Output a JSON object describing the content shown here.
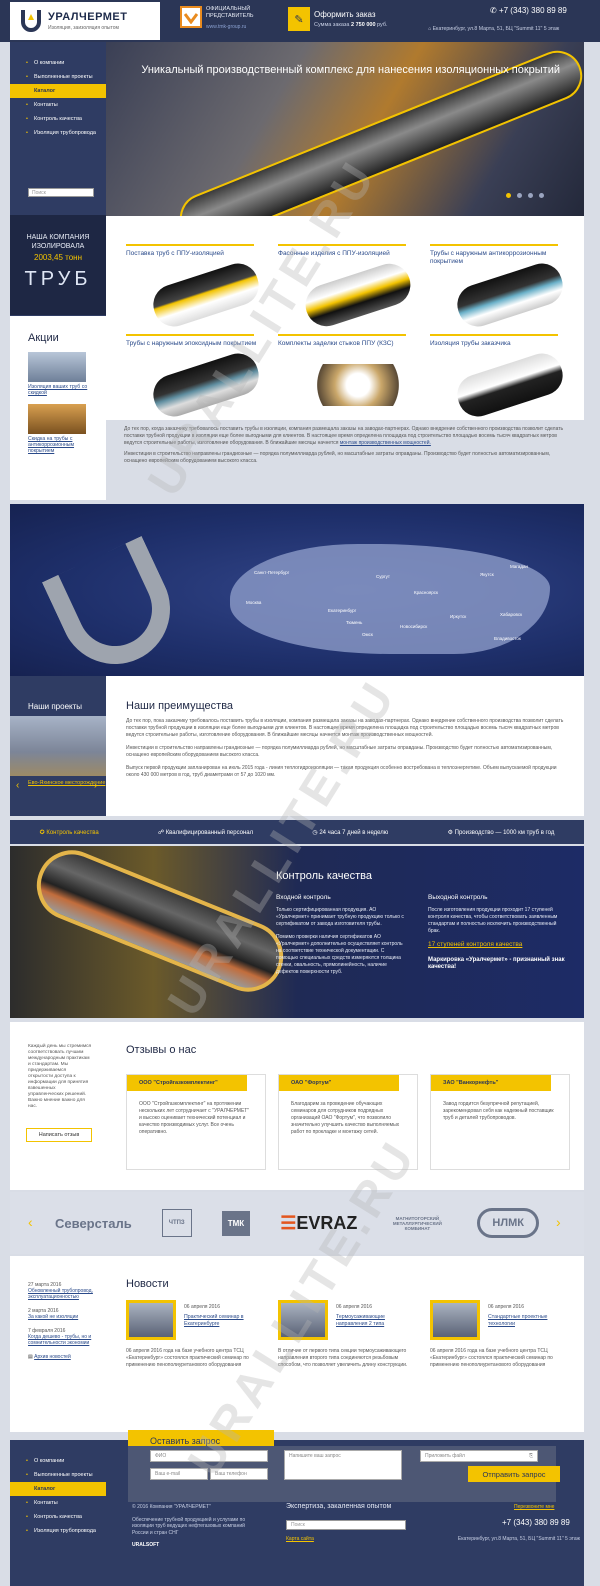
{
  "header": {
    "company": "УРАЛЧЕРМЕТ",
    "tagline": "Изоляция, заизоляция опытом",
    "dealer_line1": "ОФИЦИАЛЬНЫЙ",
    "dealer_line2": "ПРЕДСТАВИТЕЛЬ",
    "dealer_link": "www.tmk-group.ru",
    "order_title": "Оформить заказ",
    "order_sum_label": "Сумма заказа",
    "order_sum": "2 750 000",
    "order_currency": "руб.",
    "phone": "+7 (343) 380 89 89",
    "address": "Екатеринбург, ул.8 Марта, 51, БЦ \"Summit 11\" 5 этаж"
  },
  "sidebar": {
    "items": [
      "О компании",
      "Выполненные проекты",
      "Каталог",
      "Контакты",
      "Контроль качества",
      "Изоляция трубопровода"
    ],
    "active": 2,
    "search_placeholder": "Поиск"
  },
  "counter": {
    "title": "НАША КОМПАНИЯ ИЗОЛИРОВАЛА",
    "amount": "2003,45 тонн",
    "unit": "ТРУБ"
  },
  "promos": {
    "title": "Акции",
    "items": [
      "Изоляция ваших труб со скидкой",
      "Скидка на трубы с антикоррозионным покрытием"
    ]
  },
  "hero": {
    "title": "Уникальный производственный комплекс для нанесения изоляционных покрытий"
  },
  "catalog": [
    "Поставка труб с ППУ-изоляцией",
    "Фасонные изделия с ППУ-изоляцией",
    "Трубы с наружным антикоррозионным покрытием",
    "Трубы с наружным эпоксидным покрытием",
    "Комплекты заделки стыков ППУ (КЗС)",
    "Изоляция трубы заказчика"
  ],
  "about": {
    "p1": "До тех пор, когда заказчику требовалось поставить трубы в изоляции, компания размещала заказы на заводах-партнерах. Однако внедрение собственного производства позволит сделать поставки трубной продукции в изоляции еще более выгодными для клиентов. В настоящее время определена площадка под строительство площадью восемь тысяч квадратных метров ведутся строительные работы, изготовление оборудования. В ближайшие месяцы начнется",
    "p1_link": "монтаж производственных мощностей.",
    "p2": "Инвестиции в строительство направлены грандиозные — порядка полумиллиарда рублей, но масштабные затраты оправданы. Производство будет полностью автоматизированным, оснащено европейским оборудованием высокого класса."
  },
  "map": {
    "cities": [
      "Москва",
      "Санкт-Петербург",
      "Екатеринбург",
      "Сургут",
      "Тюмень",
      "Омск",
      "Новосибирск",
      "Иркутск",
      "Якутск",
      "Магадан",
      "Хабаровск",
      "Владивосток",
      "Красноярск"
    ]
  },
  "projects": {
    "title": "Наши проекты",
    "link": "Ево-Яхинское месторождение"
  },
  "advantages": {
    "title": "Наши преимущества",
    "p1": "До тех пор, пока заказчику требовалось поставить трубы в изоляции, компания размещала заказы на заводах-партнерах. Однако внедрение собственного производства позволит сделать поставки трубной продукции в изоляции еще более выгодными для клиентов. В настоящее время определена площадка под строительство площадью восемь тысяч квадратных метров ведутся строительные работы, изготовление оборудования. В ближайшие месяцы начнется монтаж производственных мощностей.",
    "p2": "Инвестиции в строительство направлены грандиозные — порядка полумиллиарда рублей, но масштабные затраты оправданы. Производство будет полностью автоматизированным, оснащено европейским оборудованием высокого класса.",
    "p3": "Выпуск первой продукции запланирован на июль 2015 года - линия теплогидроизоляции — такая продукция особенно востребована в теплоэнергетике. Объем выпускаемой продукции около 430 000 метров в год, труб диаметрами от 57 до 1020 мм."
  },
  "features": [
    "Контроль качества",
    "Квалифицированный персонал",
    "24 часа 7 дней в неделю",
    "Производство — 1000 км труб в год"
  ],
  "quality": {
    "title": "Контроль качества",
    "in_title": "Входной контроль",
    "in_p1": "Только сертифицированная продукция. АО «Уралчермет» принимает трубную продукцию только с сертификатом от завода изготовителя трубы.",
    "in_p2": "Помимо проверки наличия сертификатов АО «Уралчермет» дополнительно осуществляет контроль на соответствие технической документации. С помощью специальных средств измеряются толщина стенки, овальность, прямолинейность, наличие дефектов поверхности труб.",
    "out_title": "Выходной контроль",
    "out_p": "После изготовления продукции проходит 17 ступеней контроля качества, чтобы соответствовать заявленным стандартам и полностью исключить производственный брак.",
    "out_link": "17 ступеней контроля качества",
    "out_mark": "Маркировка «Уралчермет» - признанный знак качества!"
  },
  "reviews": {
    "side_text": "Каждый день мы стремимся соответствовать лучшим международным практикам и стандартам. Мы придерживаемся открытости доступа к информации для принятия взвешенных управленческих решений. Важно мнение важно для нас.",
    "side_button": "Написать отзыв",
    "title": "Отзывы о нас",
    "items": [
      {
        "company": "ООО \"Стройгазкомплектинг\"",
        "text": "ООО \"Стройгазкомплектинг\" на протяжении нескольких лет сотрудничает с \"УРАЛЧЕРМЕТ\" и высоко оценивает технический потенциал и качество производимых услуг. Все очень оперативно."
      },
      {
        "company": "ОАО \"Фортум\"",
        "text": "Благодарим за проведение обучающих семинаров для сотрудников подрядных организаций ОАО \"Фортум\", что позволило значительно улучшить качество выполняемых работ по прокладке и монтажу сетей."
      },
      {
        "company": "ЗАО \"Ванкорнефть\"",
        "text": "Завод гордится безупречной репутацией, зарекомендовал себя как надежный поставщик труб и деталей трубопроводов."
      }
    ]
  },
  "partners": [
    "Северсталь",
    "ЧТПЗ",
    "ТМК",
    "EVRAZ",
    "МАГНИТОГОРСКИЙ МЕТАЛЛУРГИЧЕСКИЙ КОМБИНАТ",
    "НЛМК"
  ],
  "news_side": {
    "items": [
      {
        "date": "27 марта 2016",
        "title": "Обновленный трубопровод, эксплуатационностью"
      },
      {
        "date": "2 марта 2016",
        "title": "За какой не изоляции"
      },
      {
        "date": "7 февраля 2016",
        "title": "Когда дешево - трубы, но и сомнительности экономии"
      }
    ],
    "archive": "Архив новостей"
  },
  "news": {
    "title": "Новости",
    "items": [
      {
        "date": "06 апреля 2016",
        "title": "Практический семинар в Екатеринбурге",
        "text": "06 апреля 2016 года на базе учебного центра ТСЦ «Екатеринбург» состоялся практический семинар по применению пенополиуретанового оборудования"
      },
      {
        "date": "06 апреля 2016",
        "title": "Термоусаживающие направления 2 типа",
        "text": "В отличие от первого типа секции термоусаживающего направления второго типа соединяются резьбовым способом, что позволяет увеличить длину конструкции."
      },
      {
        "date": "06 апреля 2016",
        "title": "Стандартные проектные технологии",
        "text": "06 апреля 2016 года на базе учебного центра ТСЦ «Екатеринбург» состоялся практический семинар по применению пенополиуретанового оборудования"
      }
    ]
  },
  "request": {
    "title": "Оставить запрос",
    "name_ph": "ФИО",
    "email_ph": "Ваш e-mail",
    "phone_ph": "Ваш телефон",
    "msg_ph": "Напишите ваш запрос",
    "file_ph": "Приложить файл",
    "button": "Отправить запрос"
  },
  "footer": {
    "items": [
      "О компании",
      "Выполненные проекты",
      "Каталог",
      "Контакты",
      "Контроль качества",
      "Изоляция трубопровода"
    ],
    "copyright": "© 2016 Компания \"УРАЛЧЕРМЕТ\"",
    "desc": "Обеспечение трубной продукцией и услугами по изоляции труб ведущих нефтегазовых компаний России и стран СНГ",
    "dev": "URALSOFT",
    "slogan": "Экспертиза, закаленная опытом",
    "search_placeholder": "Поиск",
    "map_link": "Карта сайта",
    "callback": "Перезвоните мне",
    "phone": "+7 (343) 380 89 89",
    "address": "Екатеринбург, ул.8 Марта, 51, БЦ \"Summit 11\" 5 этаж"
  },
  "watermark": "URALLITE.RU",
  "colors": {
    "accent": "#f3c300",
    "navy": "#2f3c63"
  }
}
